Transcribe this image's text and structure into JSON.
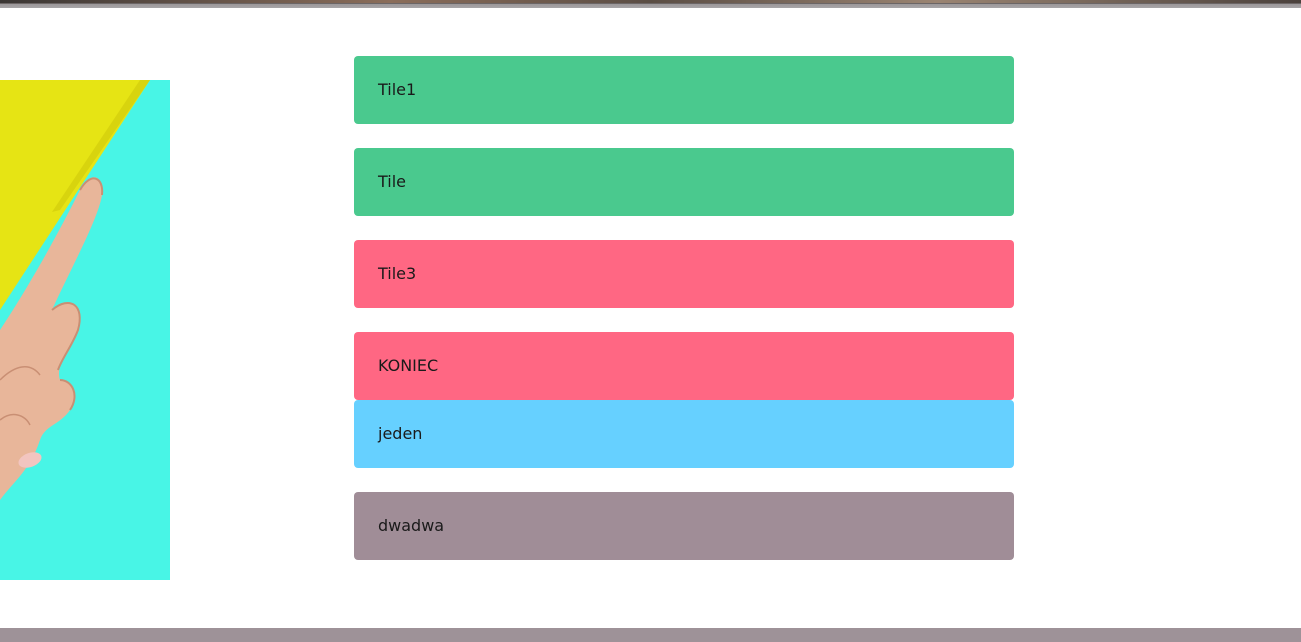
{
  "tiles": [
    {
      "label": "Tile1",
      "color": "#4ac98e"
    },
    {
      "label": "Tile",
      "color": "#4ac98e"
    },
    {
      "label": "Tile3",
      "color": "#ff6783"
    },
    {
      "label": "KONIEC",
      "color": "#ff6783"
    },
    {
      "label": "jeden",
      "color": "#66d0ff"
    },
    {
      "label": "dwadwa",
      "color": "#a08d97"
    }
  ]
}
